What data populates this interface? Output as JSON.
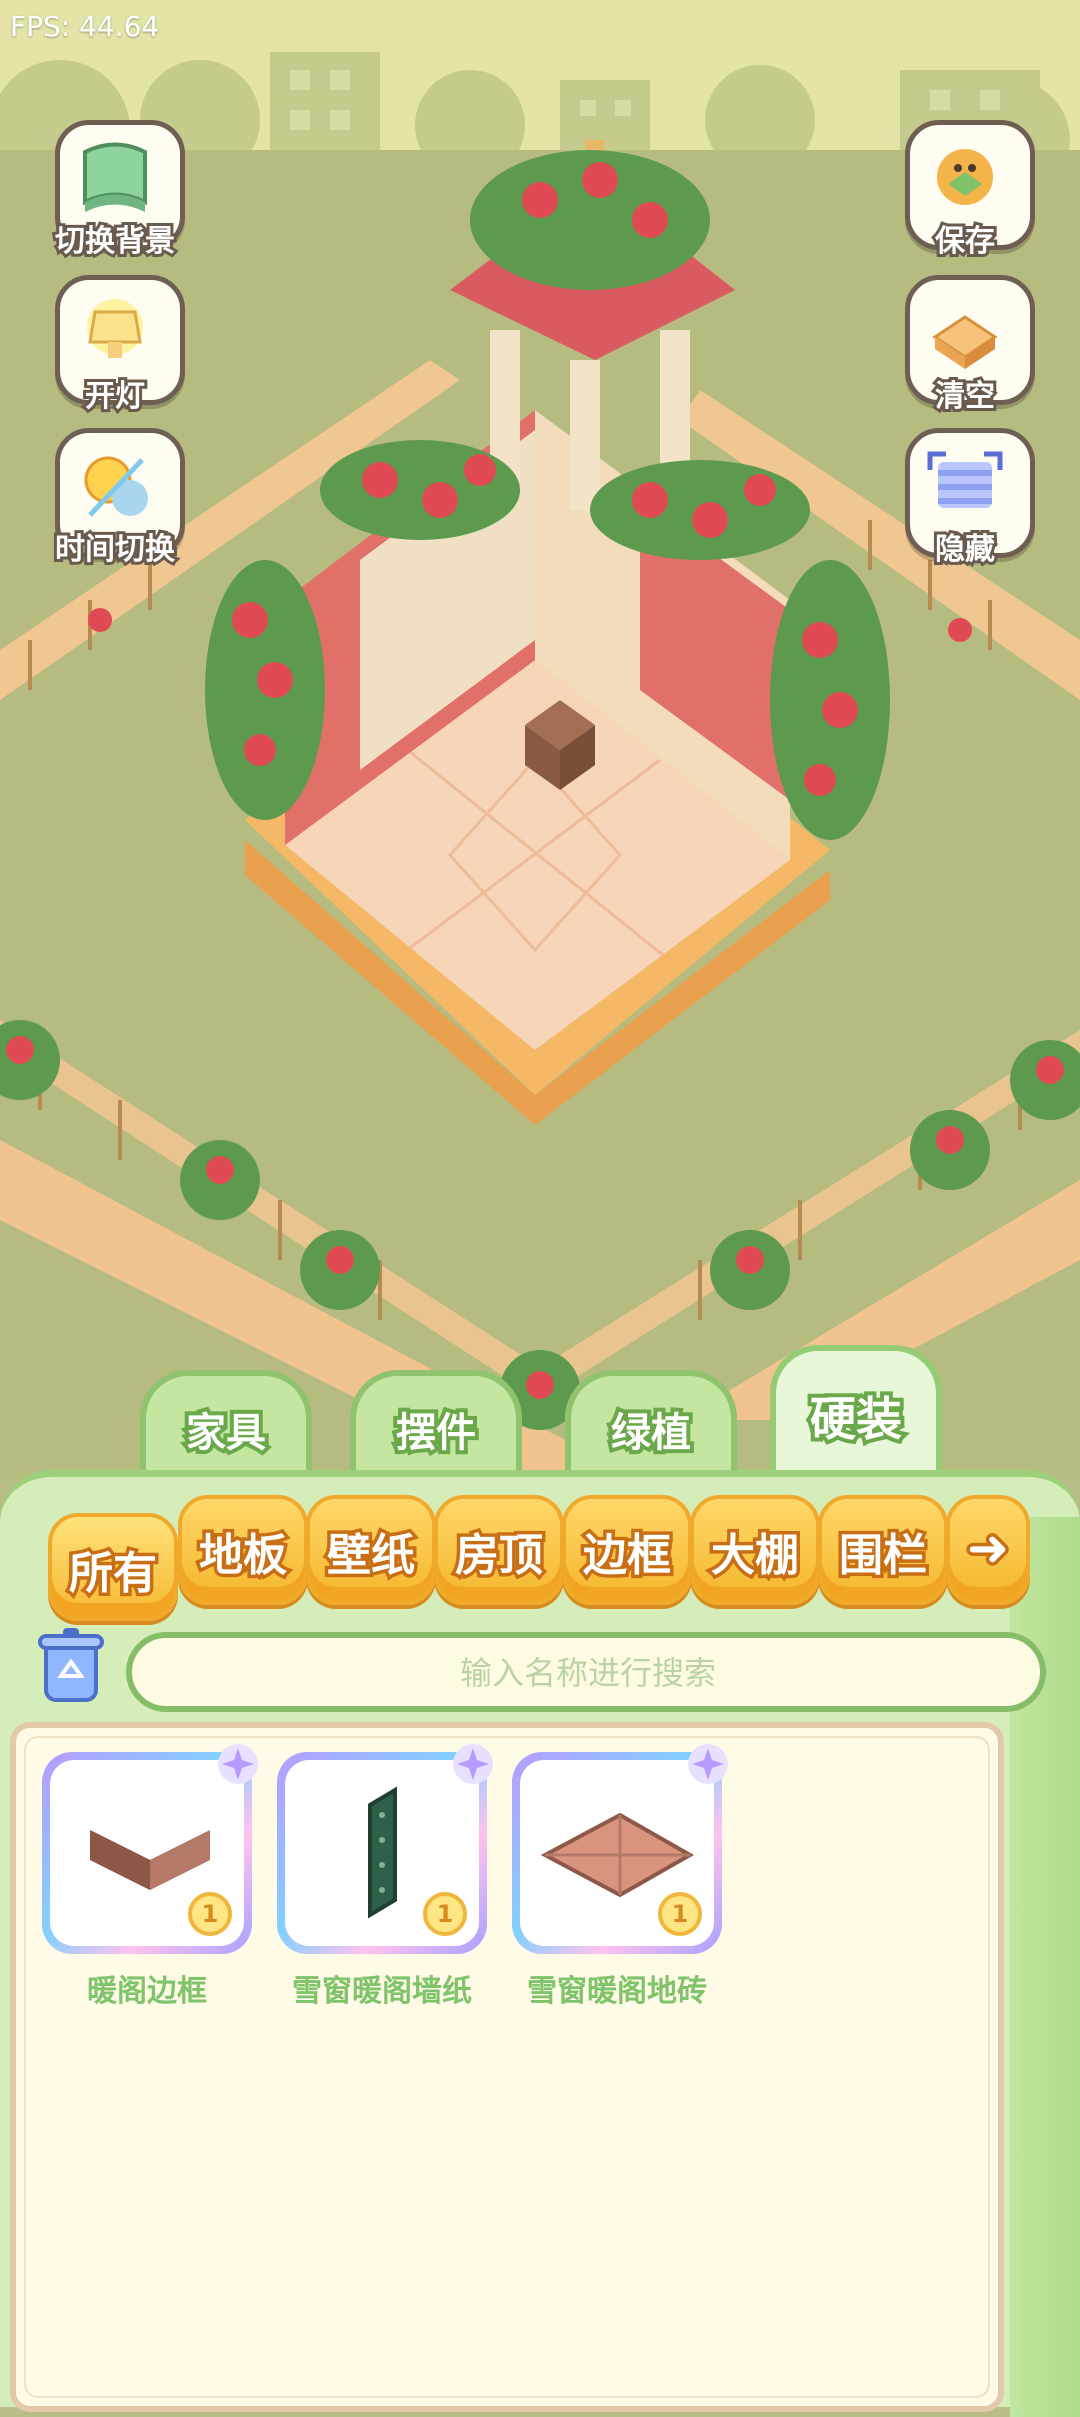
{
  "hud": {
    "fps": "FPS: 44.64"
  },
  "left_buttons": [
    {
      "label": "切换背景",
      "icon": "background-switch-icon"
    },
    {
      "label": "开灯",
      "icon": "lamp-icon"
    },
    {
      "label": "时间切换",
      "icon": "day-night-icon"
    }
  ],
  "right_buttons": [
    {
      "label": "保存",
      "icon": "save-icon"
    },
    {
      "label": "清空",
      "icon": "clear-icon"
    },
    {
      "label": "隐藏",
      "icon": "hide-icon"
    }
  ],
  "category_tabs": [
    {
      "label": "家具",
      "active": false
    },
    {
      "label": "摆件",
      "active": false
    },
    {
      "label": "绿植",
      "active": false
    },
    {
      "label": "硬装",
      "active": true
    }
  ],
  "sub_tabs": [
    {
      "label": "所有",
      "active": true
    },
    {
      "label": "地板"
    },
    {
      "label": "壁纸"
    },
    {
      "label": "房顶"
    },
    {
      "label": "边框"
    },
    {
      "label": "大棚"
    },
    {
      "label": "围栏"
    },
    {
      "label": "➜",
      "icon": "arrow-right-icon"
    }
  ],
  "search": {
    "placeholder": "输入名称进行搜索",
    "value": ""
  },
  "items": [
    {
      "name": "暖阁边框",
      "count": "1",
      "icon": "frame-icon"
    },
    {
      "name": "雪窗暖阁墙纸",
      "count": "1",
      "icon": "wallpaper-icon"
    },
    {
      "name": "雪窗暖阁地砖",
      "count": "1",
      "icon": "floor-tile-icon"
    }
  ],
  "colors": {
    "panel_green": "#d5eeb9",
    "tab_orange": "#f5b62b",
    "item_name": "#7fc36b",
    "room_wall": "#e06b6b",
    "floor": "#f6d0b0"
  }
}
